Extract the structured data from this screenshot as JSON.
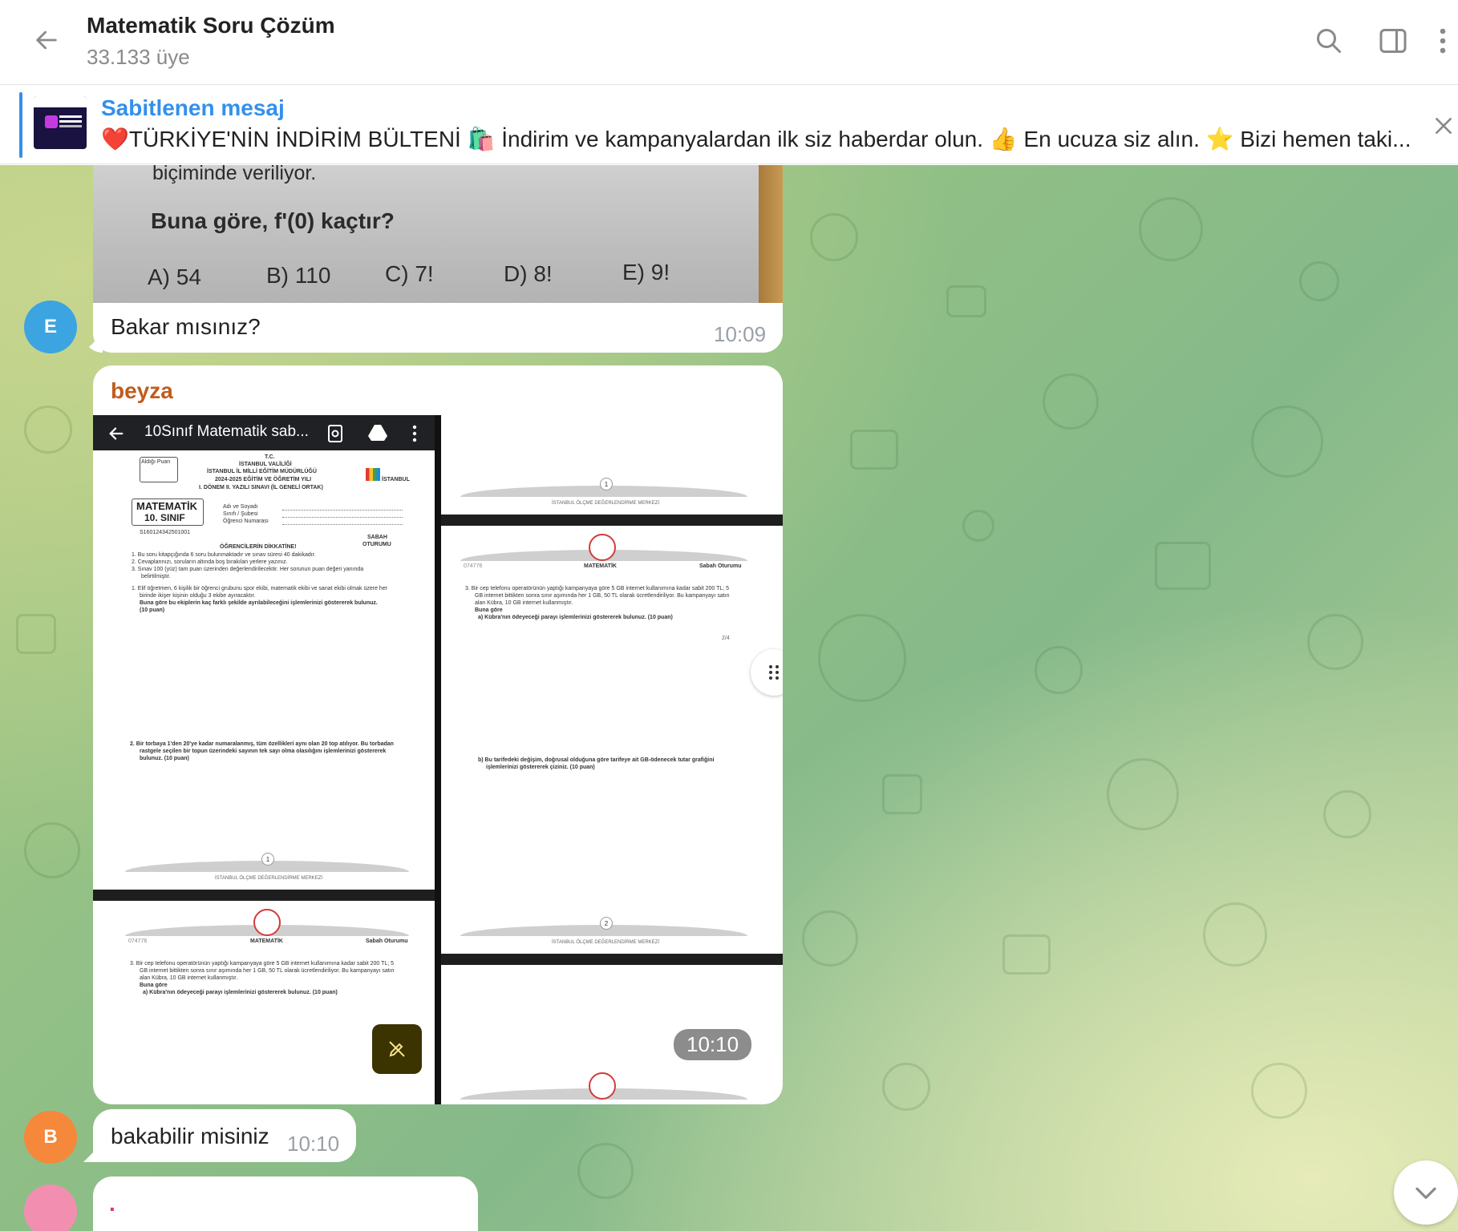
{
  "header": {
    "title": "Matematik Soru Çözüm",
    "subtitle": "33.133 üye"
  },
  "pinned": {
    "label": "Sabitlenen mesaj",
    "text": "❤️TÜRKİYE'NİN İNDİRİM BÜLTENİ 🛍️ İndirim ve kampanyalardan ilk siz haberdar olun. 👍 En ucuza siz alın. ⭐ Bizi hemen taki..."
  },
  "messages": [
    {
      "avatar": "E",
      "avatar_color": "#3ca4e0",
      "photo_lines": {
        "l1": "biçiminde veriliyor.",
        "l2": "Buna göre, f'(0) kaçtır?",
        "a": "A) 54",
        "b": "B) 110",
        "c": "C) 7!",
        "d": "D) 8!",
        "e": "E) 9!"
      },
      "text": "Bakar mısınız?",
      "time": "10:09"
    },
    {
      "sender": "beyza",
      "sender_color": "#c25b1c",
      "doc": {
        "toolbar_title": "10Sınıf Matematik sab...",
        "tc": "T.C.",
        "valilik": "İSTANBUL VALİLİĞİ",
        "mudurluk": "İSTANBUL İL MİLLİ EĞİTİM MÜDÜRLÜĞÜ",
        "yil": "2024-2025 EĞİTİM VE ÖĞRETİM YILI",
        "donem": "I. DÖNEM II. YAZILI SINAVI (İL GENELİ ORTAK)",
        "aldigi_puan": "Aldığı Puan",
        "matematik": "MATEMATİK",
        "sinif": "10. SINIF",
        "kod": "S160124342501001",
        "adi": "Adı ve Soyadı",
        "sube": "Sınıfı / Şubesi",
        "numara": "Öğrenci Numarası",
        "sabah": "SABAH",
        "oturumu": "OTURUMU",
        "istanbul": "İSTANBUL",
        "olcme": "ÖLÇME DEĞERLENDİRME MERKEZİ",
        "dikkat": "ÖĞRENCİLERİN DİKKATİNE!",
        "r1": "1.   Bu soru kitapçığında 6 soru bulunmaktadır ve sınav süresi 40 dakikadır.",
        "r2": "2.   Cevaplarınızı, soruların altında boş bırakılan yerlere yazınız.",
        "r3": "3.   Sınav 100 (yüz) tam puan üzerinden değerlendirilecektir. Her sorunun puan değeri yanında",
        "r3b": "belirtilmiştir.",
        "code": "074776",
        "q1a": "1.   Elif öğretmen, 6 kişilik bir öğrenci grubunu spor ekibi, matematik ekibi ve sanat ekibi olmak üzere her",
        "q1b": "birinde ikişer kişinin olduğu 3 ekibe ayıracaktır.",
        "q1c": "Buna göre bu ekiplerin kaç farklı şekilde ayrılabileceğini işlemlerinizi göstererek bulunuz.",
        "q1d": "(10 puan)",
        "q2a": "2.  Bir torbaya 1'den 20'ye kadar numaralanmış, tüm özellikleri aynı olan 20 top atılıyor. Bu torbadan",
        "q2b": "rastgele seçilen bir topun üzerindeki sayının tek sayı olma olasılığını işlemlerinizi göstererek",
        "q2c": "bulunuz.  (10 puan)",
        "footer": "İSTANBUL ÖLÇME DEĞERLENDİRME MERKEZİ",
        "math_hdr": "MATEMATİK",
        "sabah_hdr": "Sabah Oturumu",
        "q3a": "3.   Bir cep telefonu operatörünün yaptığı kampanyaya göre 5 GB internet kullanımına kadar sabit 200 TL; 5",
        "q3b": "GB internet bittikten sonra sınır aşımında her 1 GB, 50 TL olarak ücretlendiriliyor. Bu kampanyayı satın",
        "q3c": "alan Kübra, 10 GB internet kullanmıştır.",
        "q3d": "Buna göre",
        "q3e": "a)  Kübra'nın ödeyeceği parayı işlemlerinizi göstererek bulunuz. (10 puan)",
        "q3f": "b)  Bu tarifedeki değişim, doğrusal olduğuna göre tarifeye ait GB-ödenecek tutar grafiğini",
        "q3g": "işlemlerinizi göstererek çiziniz. (10 puan)",
        "page1": "1",
        "page2": "2",
        "pager": "2/4"
      },
      "time": "10:10"
    },
    {
      "avatar": "B",
      "avatar_color": "#f5883a",
      "text": "bakabilir misiniz",
      "time": "10:10"
    },
    {
      "avatar": "",
      "avatar_color": "#f28fb0",
      "text": ".",
      "time": ""
    }
  ]
}
